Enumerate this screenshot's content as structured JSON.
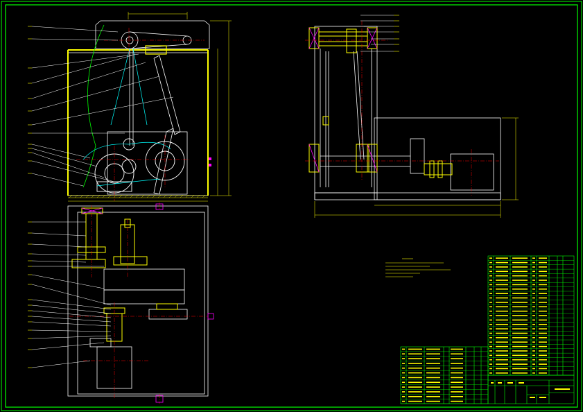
{
  "drawing": {
    "background": "#000000",
    "frame_color": "#00ff00",
    "line_colors": {
      "outline": "#ffffff",
      "mechanism": "#ffff00",
      "centerline": "#ff0000",
      "leader": "#ffff00",
      "table": "#00ff00",
      "hatch": "#ff00ff",
      "dimension": "#ffff00"
    }
  },
  "views": {
    "front": "front-elevation",
    "top": "top-plan",
    "side": "side-elevation"
  },
  "notes": {
    "title_row": "· · · ·",
    "lines": [
      "",
      "",
      "",
      "",
      ""
    ]
  },
  "parts_table": {
    "rows_upper": 27,
    "rows_lower": 12
  }
}
